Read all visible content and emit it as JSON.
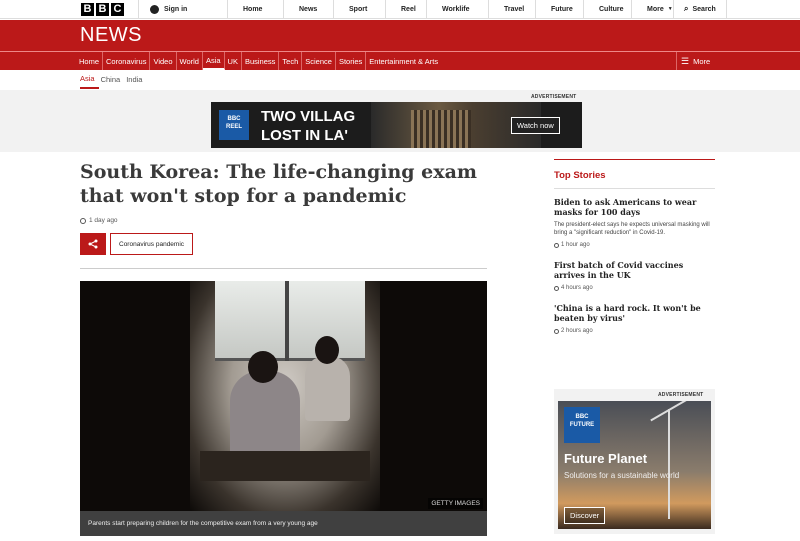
{
  "logo": [
    "B",
    "B",
    "C"
  ],
  "topbar": {
    "signin": "Sign in",
    "nav": [
      "Home",
      "News",
      "Sport",
      "Reel",
      "Worklife",
      "Travel",
      "Future",
      "Culture",
      "More"
    ],
    "search": "Search"
  },
  "brand": "NEWS",
  "navbar": {
    "items": [
      "Home",
      "Coronavirus",
      "Video",
      "World",
      "Asia",
      "UK",
      "Business",
      "Tech",
      "Science",
      "Stories",
      "Entertainment & Arts"
    ],
    "more": "More"
  },
  "subnav": [
    "Asia",
    "China",
    "India"
  ],
  "advertisement_label": "ADVERTISEMENT",
  "top_ad": {
    "brand_line1": "BBC",
    "brand_line2": "REEL",
    "line1": "TWO VILLAG",
    "line2": "LOST IN LA'",
    "button": "Watch now"
  },
  "article": {
    "headline": "South Korea: The life-changing exam that won't stop for a pandemic",
    "timestamp": "1 day ago",
    "tag": "Coronavirus pandemic",
    "photo_credit": "GETTY IMAGES",
    "caption": "Parents start preparing children for the competitive exam from a very young age"
  },
  "sidebar": {
    "title": "Top Stories",
    "stories": [
      {
        "title": "Biden to ask Americans to wear masks for 100 days",
        "summary": "The president-elect says he expects universal masking will bring a \"significant reduction\" in Covid-19.",
        "time": "1 hour ago"
      },
      {
        "title": "First batch of Covid vaccines arrives in the UK",
        "summary": "",
        "time": "4 hours ago"
      },
      {
        "title": "'China is a hard rock. It won't be beaten by virus'",
        "summary": "",
        "time": "2 hours ago"
      }
    ]
  },
  "side_ad": {
    "brand_line1": "BBC",
    "brand_line2": "FUTURE",
    "title": "Future Planet",
    "subtitle": "Solutions for a sustainable world",
    "button": "Discover"
  },
  "colors": {
    "brand_red": "#bb1919",
    "ad_blue": "#1a5aa6"
  }
}
